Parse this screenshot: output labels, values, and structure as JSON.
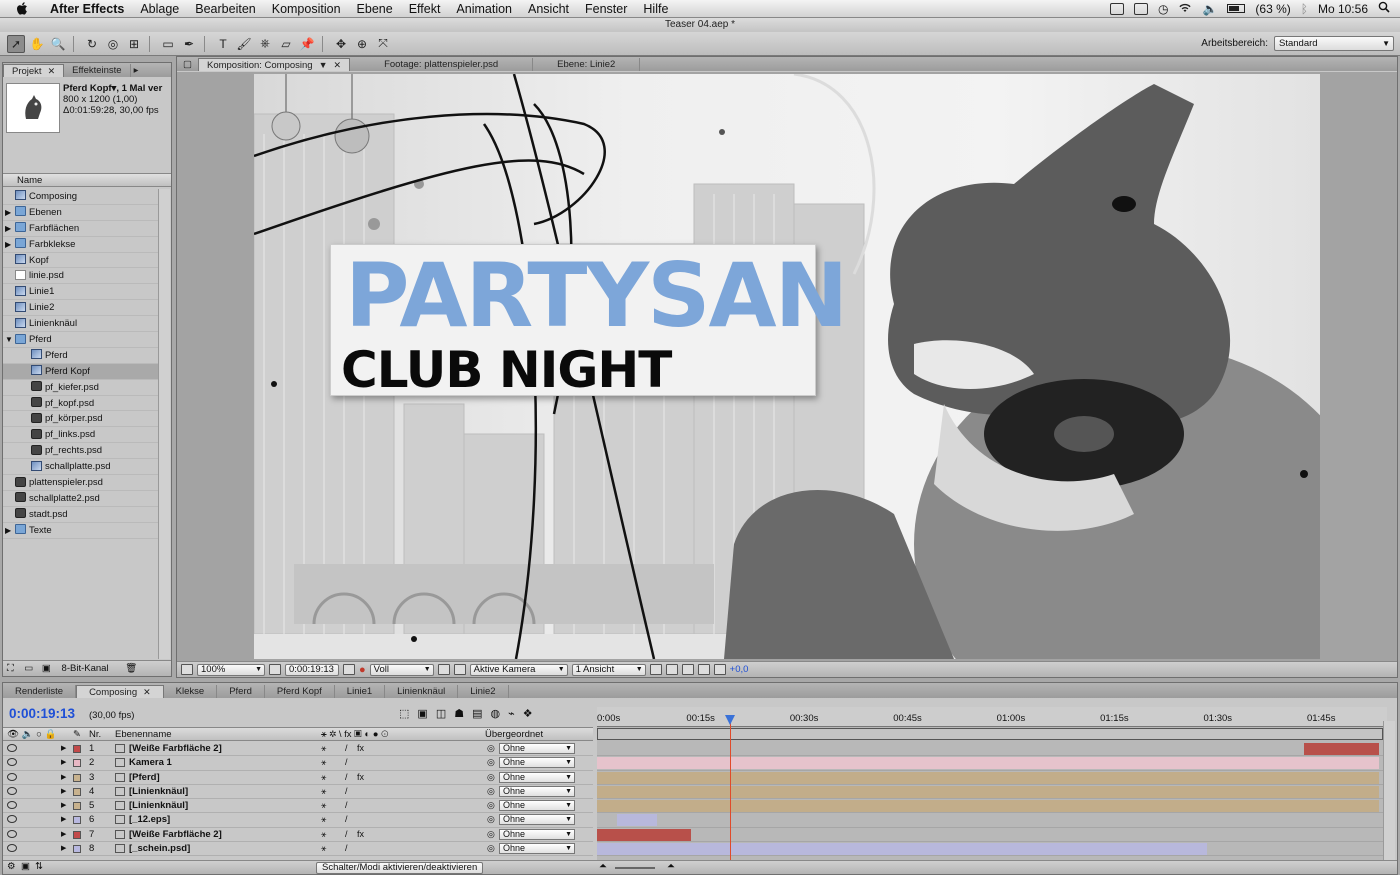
{
  "menubar": {
    "items": [
      "After Effects",
      "Ablage",
      "Bearbeiten",
      "Komposition",
      "Ebene",
      "Effekt",
      "Animation",
      "Ansicht",
      "Fenster",
      "Hilfe"
    ],
    "battery": "(63 %)",
    "clock": "Mo 10:56"
  },
  "window": {
    "title": "Teaser 04.aep *"
  },
  "toolbar": {
    "tools": [
      {
        "icon": "selection-arrow-icon",
        "glyph": "➚"
      },
      {
        "icon": "hand-icon",
        "glyph": "✋"
      },
      {
        "icon": "zoom-icon",
        "glyph": "🔍"
      },
      {
        "icon": "rotate-icon",
        "glyph": "↻"
      },
      {
        "icon": "camera-orbit-icon",
        "glyph": "◎"
      },
      {
        "icon": "pan-behind-icon",
        "glyph": "⊞"
      },
      {
        "icon": "rectangle-mask-icon",
        "glyph": "▭"
      },
      {
        "icon": "pen-icon",
        "glyph": "✒"
      },
      {
        "icon": "type-icon",
        "glyph": "T"
      },
      {
        "icon": "brush-icon",
        "glyph": "🖌"
      },
      {
        "icon": "clone-stamp-icon",
        "glyph": "⎈"
      },
      {
        "icon": "eraser-icon",
        "glyph": "▱"
      },
      {
        "icon": "puppet-pin-icon",
        "glyph": "📌"
      }
    ],
    "workspace_label": "Arbeitsbereich:",
    "workspace_value": "Standard"
  },
  "project": {
    "tabs": [
      "Projekt",
      "Effekteinste"
    ],
    "info": {
      "name": "Pferd Kopf▾, 1 Mal ver",
      "size": "800 x 1200 (1,00)",
      "duration": "Δ0:01:59:28, 30,00 fps"
    },
    "column_name": "Name",
    "items": [
      {
        "label": "Composing",
        "type": "comp",
        "indent": 0,
        "twirl": ""
      },
      {
        "label": "Ebenen",
        "type": "folder",
        "indent": 0,
        "twirl": "▶"
      },
      {
        "label": "Farbflächen",
        "type": "folder",
        "indent": 0,
        "twirl": "▶"
      },
      {
        "label": "Farbklekse",
        "type": "folder",
        "indent": 0,
        "twirl": "▶"
      },
      {
        "label": "Kopf",
        "type": "comp",
        "indent": 0,
        "twirl": ""
      },
      {
        "label": "linie.psd",
        "type": "psd",
        "indent": 0,
        "twirl": ""
      },
      {
        "label": "Linie1",
        "type": "comp",
        "indent": 0,
        "twirl": ""
      },
      {
        "label": "Linie2",
        "type": "comp",
        "indent": 0,
        "twirl": ""
      },
      {
        "label": "Linienknäul",
        "type": "comp",
        "indent": 0,
        "twirl": ""
      },
      {
        "label": "Pferd",
        "type": "folder",
        "indent": 0,
        "twirl": "▼"
      },
      {
        "label": "Pferd",
        "type": "comp",
        "indent": 1,
        "twirl": ""
      },
      {
        "label": "Pferd Kopf",
        "type": "comp",
        "indent": 1,
        "twirl": "",
        "selected": true
      },
      {
        "label": "pf_kiefer.psd",
        "type": "layer",
        "indent": 1,
        "twirl": ""
      },
      {
        "label": "pf_kopf.psd",
        "type": "layer",
        "indent": 1,
        "twirl": ""
      },
      {
        "label": "pf_körper.psd",
        "type": "layer",
        "indent": 1,
        "twirl": ""
      },
      {
        "label": "pf_links.psd",
        "type": "layer",
        "indent": 1,
        "twirl": ""
      },
      {
        "label": "pf_rechts.psd",
        "type": "layer",
        "indent": 1,
        "twirl": ""
      },
      {
        "label": "schallplatte.psd",
        "type": "comp",
        "indent": 1,
        "twirl": ""
      },
      {
        "label": "plattenspieler.psd",
        "type": "layer",
        "indent": 0,
        "twirl": ""
      },
      {
        "label": "schallplatte2.psd",
        "type": "layer",
        "indent": 0,
        "twirl": ""
      },
      {
        "label": "stadt.psd",
        "type": "layer",
        "indent": 0,
        "twirl": ""
      },
      {
        "label": "Texte",
        "type": "folder",
        "indent": 0,
        "twirl": "▶"
      }
    ],
    "bit_depth": "8-Bit-Kanal"
  },
  "comp_panel": {
    "tabs": [
      "Komposition: Composing",
      "Footage: plattenspieler.psd",
      "Ebene: Linie2"
    ],
    "title_line1": "PARTYSAN",
    "title_line2": "CLUB NIGHT",
    "zoom": "100%",
    "timecode": "0:00:19:13",
    "resolution": "Voll",
    "camera": "Aktive Kamera",
    "views": "1 Ansicht",
    "exposure": "+0,0",
    "colors": {
      "title_blue": "#7da6d9",
      "timecode_blue": "#1e4fd6"
    }
  },
  "timeline": {
    "tabs": [
      "Renderliste",
      "Composing",
      "Klekse",
      "Pferd",
      "Pferd Kopf",
      "Linie1",
      "Linienknäul",
      "Linie2"
    ],
    "active_tab": "Composing",
    "current_time": "0:00:19:13",
    "fps": "(30,00 fps)",
    "col_nr": "Nr.",
    "col_name": "Ebenenname",
    "col_parent": "Übergeordnet",
    "ticks": [
      "0:00s",
      "00:15s",
      "00:30s",
      "00:45s",
      "01:00s",
      "01:15s",
      "01:30s",
      "01:45s"
    ],
    "layers": [
      {
        "nr": "1",
        "name": "[Weiße Farbfläche 2]",
        "label_color": "#c24a4a",
        "parent": "Ohne",
        "fx": "fx",
        "bar_start": 0.904,
        "bar_end": 1.0,
        "bar_color": "#b8504a"
      },
      {
        "nr": "2",
        "name": "Kamera 1",
        "label_color": "#e8b8c4",
        "parent": "Ohne",
        "fx": "",
        "bar_start": 0.0,
        "bar_end": 1.0,
        "bar_color": "#e6c3cc"
      },
      {
        "nr": "3",
        "name": "[Pferd]",
        "label_color": "#c8b28e",
        "parent": "Ohne",
        "fx": "fx",
        "bar_start": 0.0,
        "bar_end": 1.0,
        "bar_color": "#c2ad8a"
      },
      {
        "nr": "4",
        "name": "[Linienknäul]",
        "label_color": "#c8b28e",
        "parent": "Ohne",
        "fx": "",
        "bar_start": 0.0,
        "bar_end": 1.0,
        "bar_color": "#c2ad8a"
      },
      {
        "nr": "5",
        "name": "[Linienknäul]",
        "label_color": "#c8b28e",
        "parent": "Ohne",
        "fx": "",
        "bar_start": 0.0,
        "bar_end": 1.0,
        "bar_color": "#c2ad8a"
      },
      {
        "nr": "6",
        "name": "[_12.eps]",
        "label_color": "#b8b8e0",
        "parent": "Ohne",
        "fx": "",
        "bar_start": 0.025,
        "bar_end": 0.077,
        "bar_color": "#b8b8dc"
      },
      {
        "nr": "7",
        "name": "[Weiße Farbfläche 2]",
        "label_color": "#c24a4a",
        "parent": "Ohne",
        "fx": "fx",
        "bar_start": 0.0,
        "bar_end": 0.12,
        "bar_color": "#b8504a"
      },
      {
        "nr": "8",
        "name": "[_schein.psd]",
        "label_color": "#b8b8e0",
        "parent": "Ohne",
        "fx": "",
        "bar_start": 0.0,
        "bar_end": 0.78,
        "bar_color": "#b8b8dc"
      }
    ],
    "playhead_fraction": 0.17,
    "toggle_button": "Schalter/Modi aktivieren/deaktivieren"
  }
}
